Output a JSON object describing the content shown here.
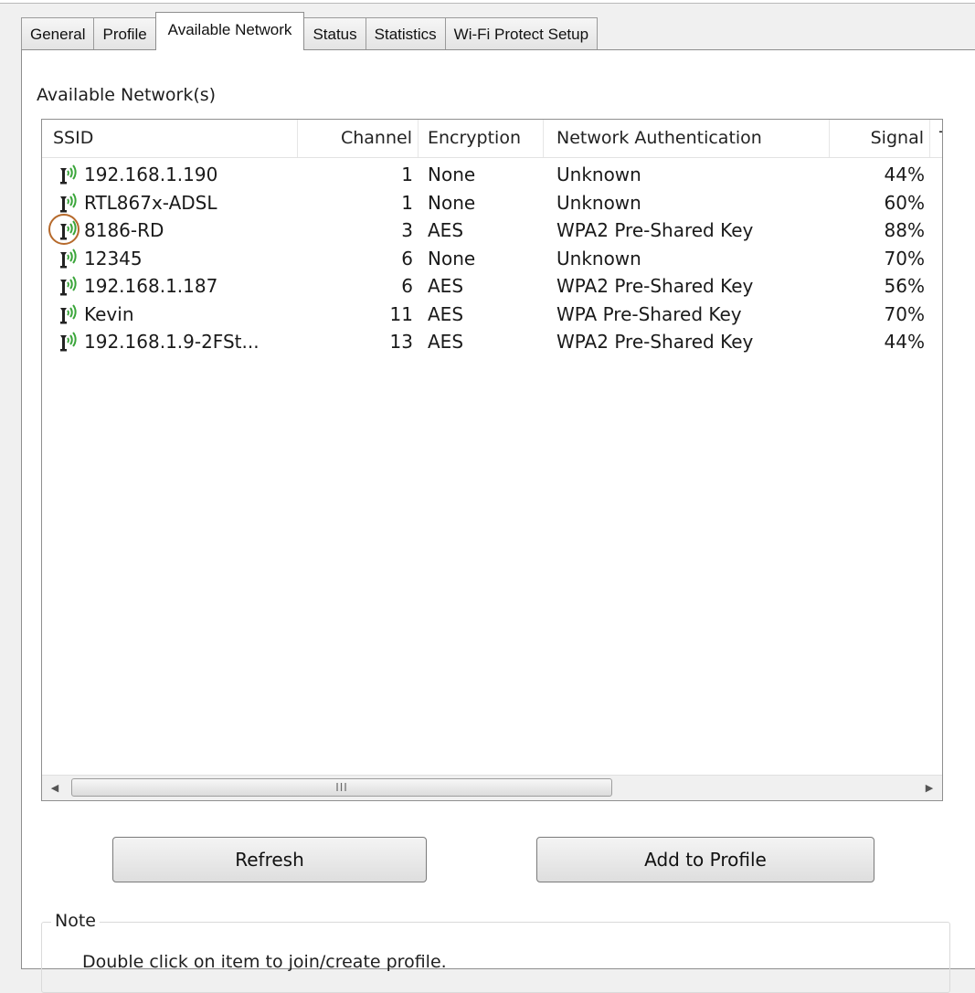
{
  "tabs": [
    {
      "label": "General",
      "active": false
    },
    {
      "label": "Profile",
      "active": false
    },
    {
      "label": "Available Network",
      "active": true
    },
    {
      "label": "Status",
      "active": false
    },
    {
      "label": "Statistics",
      "active": false
    },
    {
      "label": "Wi-Fi Protect Setup",
      "active": false
    }
  ],
  "panel": {
    "title": "Available Network(s)"
  },
  "list": {
    "columns": [
      "SSID",
      "Channel",
      "Encryption",
      "Network Authentication",
      "Signal",
      "T"
    ],
    "rows": [
      {
        "ssid": "192.168.1.190",
        "channel": "1",
        "encryption": "None",
        "auth": "Unknown",
        "signal": "44%",
        "type": "I"
      },
      {
        "ssid": "RTL867x-ADSL",
        "channel": "1",
        "encryption": "None",
        "auth": "Unknown",
        "signal": "60%",
        "type": "I"
      },
      {
        "ssid": "8186-RD",
        "channel": "3",
        "encryption": "AES",
        "auth": "WPA2 Pre-Shared Key",
        "signal": "88%",
        "type": "I",
        "highlighted": true
      },
      {
        "ssid": "12345",
        "channel": "6",
        "encryption": "None",
        "auth": "Unknown",
        "signal": "70%",
        "type": "I"
      },
      {
        "ssid": "192.168.1.187",
        "channel": "6",
        "encryption": "AES",
        "auth": "WPA2 Pre-Shared Key",
        "signal": "56%",
        "type": "I"
      },
      {
        "ssid": "Kevin",
        "channel": "11",
        "encryption": "AES",
        "auth": "WPA Pre-Shared Key",
        "signal": "70%",
        "type": "I"
      },
      {
        "ssid": "192.168.1.9-2FSt...",
        "channel": "13",
        "encryption": "AES",
        "auth": "WPA2 Pre-Shared Key",
        "signal": "44%",
        "type": "I"
      }
    ],
    "row_icon": "wifi-signal-icon"
  },
  "scrollbar": {
    "grip": "III",
    "left_icon": "arrow-left-icon",
    "right_icon": "arrow-right-icon"
  },
  "buttons": {
    "refresh": "Refresh",
    "add_to_profile": "Add to Profile"
  },
  "note": {
    "label": "Note",
    "text": "Double click on item to join/create profile."
  },
  "colors": {
    "wifi_green": "#3aa53a",
    "selection_ring": "#b66a2c",
    "panel_bg": "#ffffff",
    "window_bg": "#f0f0f0"
  }
}
